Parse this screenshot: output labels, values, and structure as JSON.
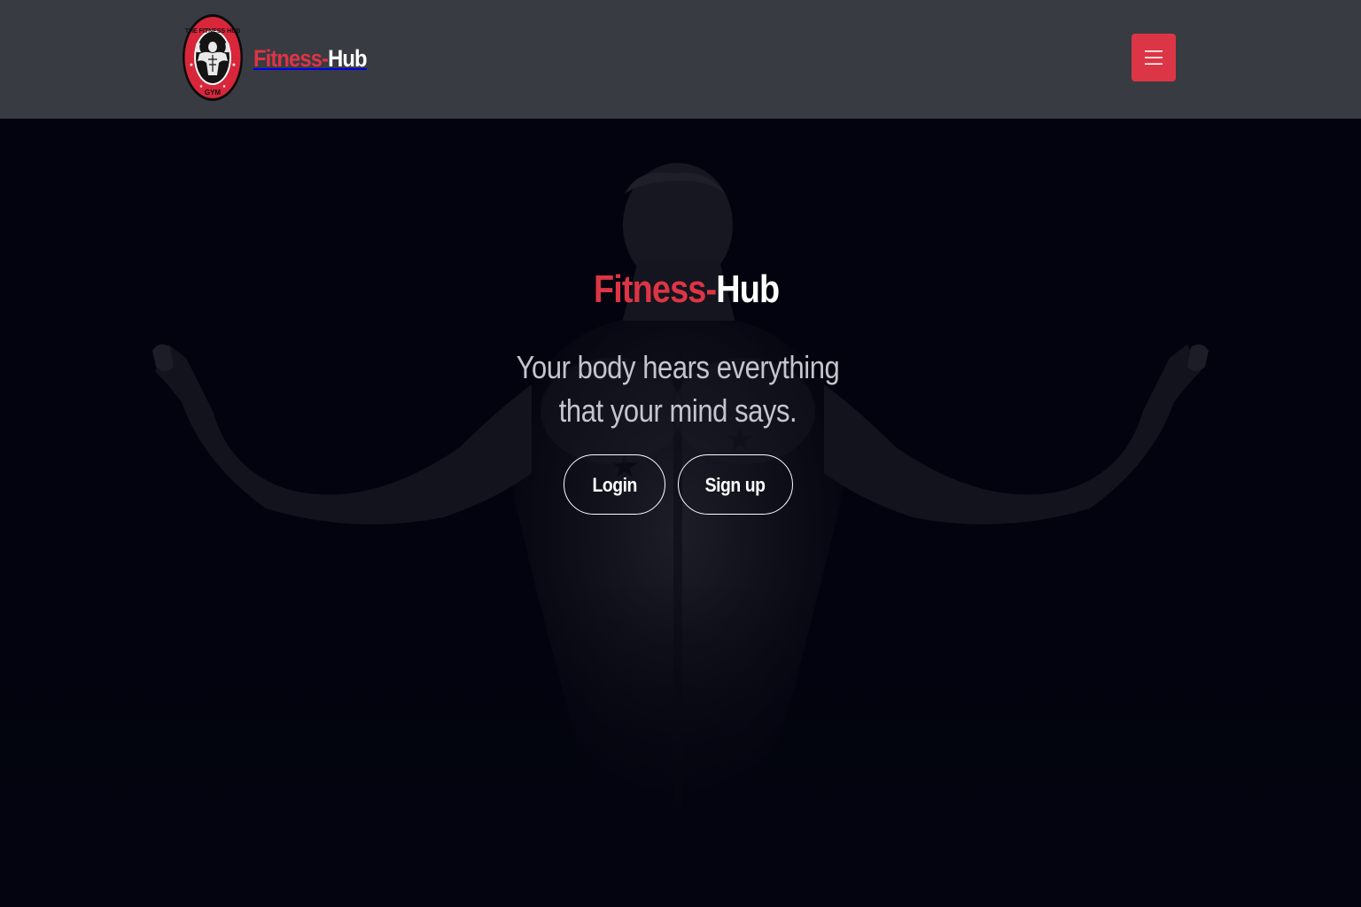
{
  "navbar": {
    "logo": {
      "ring_text_top": "THE FITNESS HUB",
      "ring_text_bottom": "GYM",
      "icon": "gym-bodybuilder-logo"
    },
    "brand_part1": "Fitness-",
    "brand_part2": "Hub",
    "menu_icon": "hamburger-menu-icon"
  },
  "hero": {
    "title_part1": "Fitness-",
    "title_part2": "Hub",
    "tagline_line1": "Your body hears everything",
    "tagline_line2": "that your mind says.",
    "login_label": "Login",
    "signup_label": "Sign up",
    "background": "muscular-back-silhouette"
  },
  "colors": {
    "accent": "#dc3545",
    "navbar_bg": "#383b41",
    "hero_bg": "#03040f",
    "text_light": "#c3c6cc"
  }
}
